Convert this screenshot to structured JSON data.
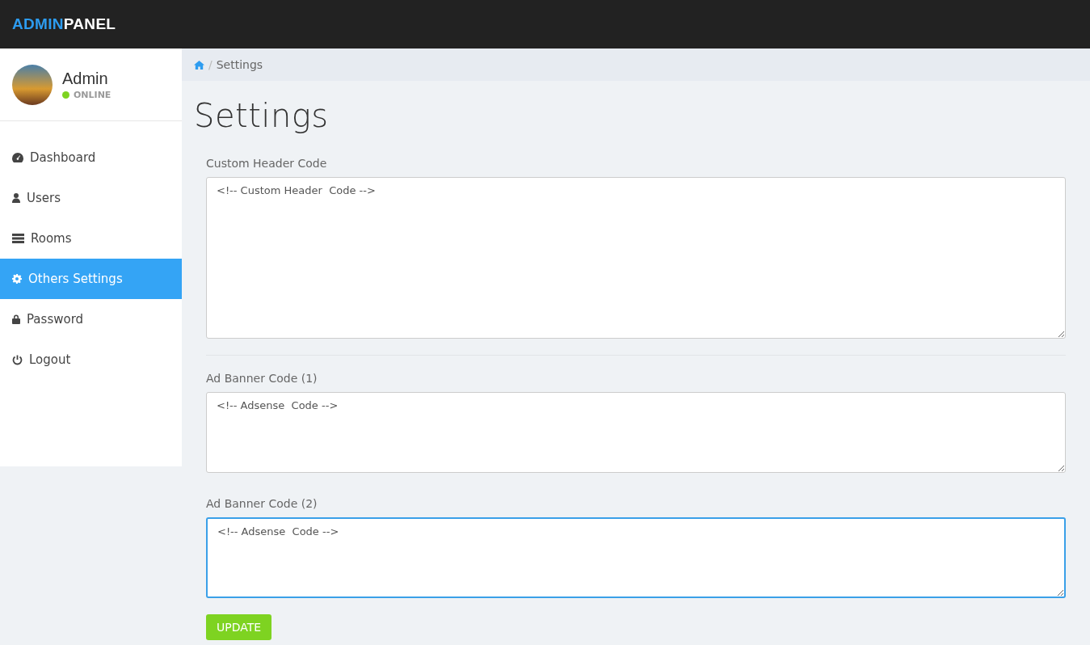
{
  "brand": {
    "part_1": "ADMIN",
    "part_2": "PANEL"
  },
  "profile": {
    "name": "Admin",
    "status": "ONLINE",
    "online": true
  },
  "sidebar": {
    "items": [
      {
        "label": "Dashboard",
        "kind": "dashboard",
        "selected": false
      },
      {
        "label": "Users",
        "kind": "user",
        "selected": false
      },
      {
        "label": "Rooms",
        "kind": "server",
        "selected": false
      },
      {
        "label": "Others Settings",
        "kind": "gear",
        "selected": true
      },
      {
        "label": "Password",
        "kind": "lock",
        "selected": false
      },
      {
        "label": "Logout",
        "kind": "power",
        "selected": false
      }
    ]
  },
  "breadcrumb": {
    "separator": "/",
    "current": "Settings"
  },
  "page_title": "Settings",
  "sections": [
    {
      "fields": [
        {
          "label": "Custom Header Code",
          "value": "<!-- Custom Header  Code -->",
          "kind": "large",
          "focused": false
        }
      ]
    },
    {
      "fields": [
        {
          "label": "Ad Banner Code (1)",
          "value": "<!-- Adsense  Code -->",
          "kind": "small",
          "focused": false
        },
        {
          "label": "Ad Banner Code (2)",
          "value": "<!-- Adsense  Code -->",
          "kind": "small",
          "focused": true
        }
      ]
    }
  ],
  "submit": {
    "label": "UPDATE"
  }
}
